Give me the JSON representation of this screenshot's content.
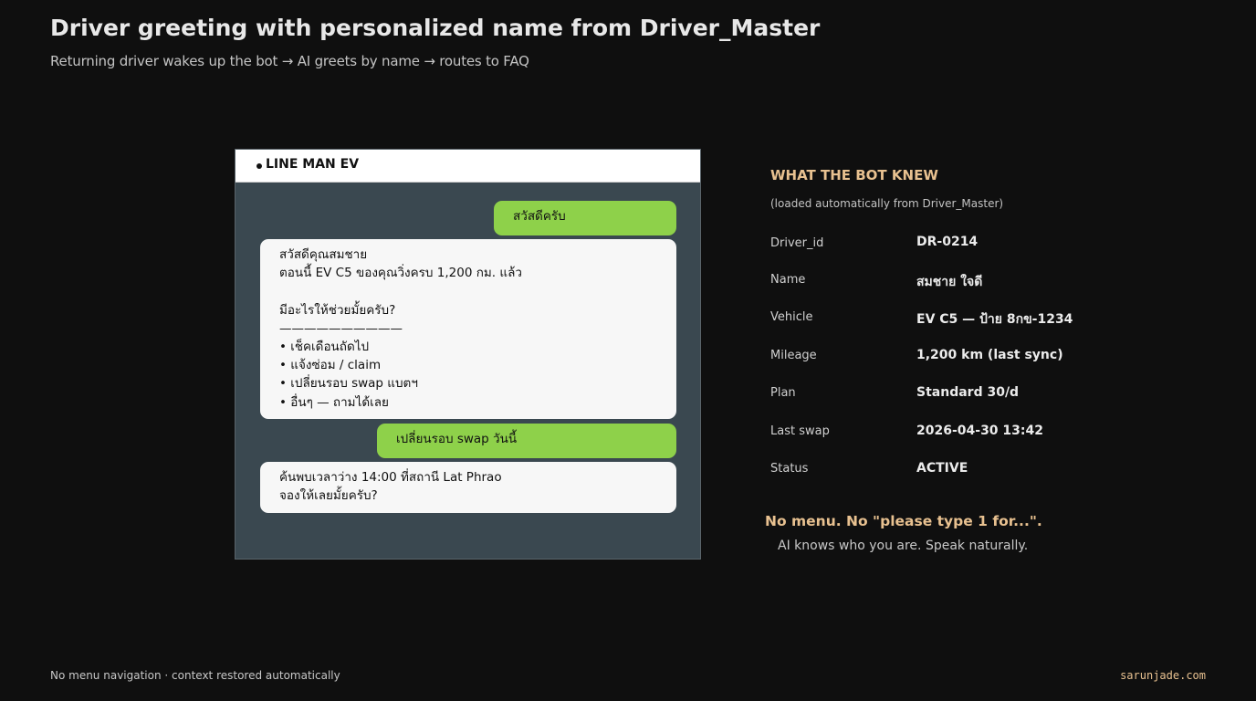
{
  "header": {
    "title": "Driver greeting with personalized name from Driver_Master",
    "subtitle": "Returning driver wakes up the bot → AI greets by name → routes to FAQ"
  },
  "chat": {
    "app_name": "LINE MAN EV",
    "messages": [
      {
        "sender": "user",
        "text": "สวัสดีครับ"
      },
      {
        "sender": "bot",
        "text": "สวัสดีคุณสมชาย\nตอนนี้ EV C5 ของคุณวิ่งครบ 1,200 กม. แล้ว\n\nมีอะไรให้ช่วยมั้ยครับ?\n——————————\n• เช็คเดือนถัดไป\n• แจ้งซ่อม / claim\n• เปลี่ยนรอบ swap แบตฯ\n• อื่นๆ — ถามได้เลย"
      },
      {
        "sender": "user",
        "text": "เปลี่ยนรอบ swap วันนี้"
      },
      {
        "sender": "bot",
        "text": "ค้นพบเวลาว่าง 14:00 ที่สถานี Lat Phrao\nจองให้เลยมั้ยครับ?"
      }
    ],
    "colors": {
      "user_bubble": "#8ed14a",
      "bot_bubble": "#f7f7f7",
      "background": "#3a4850"
    }
  },
  "panel": {
    "title": "WHAT THE BOT KNEW",
    "subtitle": "(loaded automatically from Driver_Master)",
    "fields": [
      {
        "label": "Driver_id",
        "value": "DR-0214"
      },
      {
        "label": "Name",
        "value": "สมชาย ใจดี"
      },
      {
        "label": "Vehicle",
        "value": "EV C5 — ป้าย 8กข-1234"
      },
      {
        "label": "Mileage",
        "value": "1,200 km (last sync)"
      },
      {
        "label": "Plan",
        "value": "Standard 30/d"
      },
      {
        "label": "Last swap",
        "value": "2026-04-30 13:42"
      },
      {
        "label": "Status",
        "value": "ACTIVE"
      }
    ],
    "callout": "No menu. No \"please type 1 for...\".",
    "callout_sub": "AI knows who you are. Speak naturally."
  },
  "footer": {
    "left": "No menu navigation · context restored automatically",
    "right": "sarunjade.com"
  },
  "accent_color": "#e8c190"
}
